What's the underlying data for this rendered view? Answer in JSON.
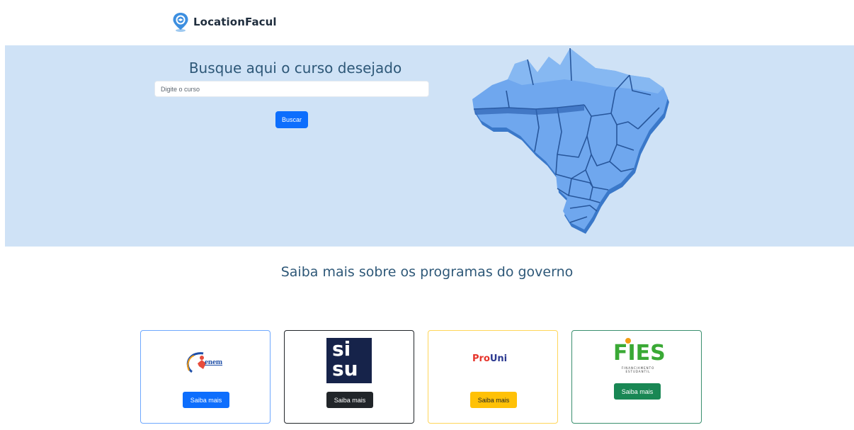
{
  "navbar": {
    "brand": "LocationFacul"
  },
  "hero": {
    "title": "Busque aqui o curso desejado",
    "search_placeholder": "Digite o curso",
    "search_value": "",
    "search_button": "Buscar"
  },
  "programs": {
    "title": "Saiba mais sobre os programas do governo",
    "cards": [
      {
        "logo_text": "enem",
        "button": "Saiba mais",
        "color": "#0d6efd"
      },
      {
        "logo_line1": "si",
        "logo_line2": "su",
        "button": "Saiba mais",
        "color": "#212529"
      },
      {
        "logo_text_a": "Pro",
        "logo_text_b": "Uni",
        "button": "Saiba mais",
        "color": "#ffc107"
      },
      {
        "logo_text": "FIES",
        "logo_sub": "FINANCIAMENTO ESTUDANTIL",
        "button": "Saiba mais",
        "color": "#198754"
      }
    ]
  },
  "colors": {
    "primary": "#0d6efd",
    "hero_bg": "#cfe2f6",
    "heading": "#2e5878"
  }
}
